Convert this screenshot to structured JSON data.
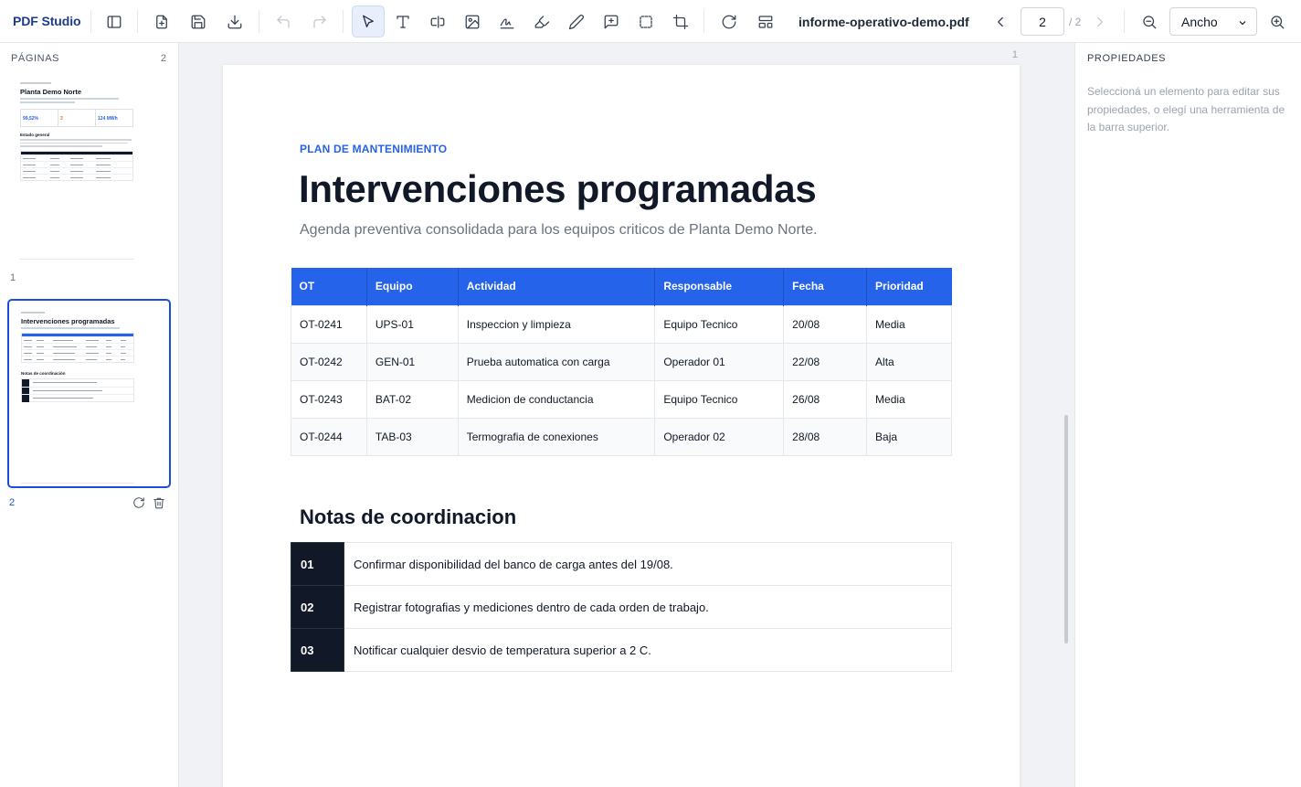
{
  "app": {
    "name": "PDF Studio"
  },
  "toolbar": {
    "filename": "informe-operativo-demo.pdf",
    "current_page": "2",
    "total_pages": "/ 2",
    "zoom": "Ancho",
    "icons": [
      "sidebar-icon",
      "add-file-icon",
      "save-icon",
      "download-icon",
      "undo-icon",
      "redo-icon",
      "cursor-icon",
      "text-icon",
      "text-field-icon",
      "image-icon",
      "signature-icon",
      "highlighter-icon",
      "pencil-icon",
      "comment-icon",
      "rectangle-icon",
      "crop-icon",
      "rotate-icon",
      "layout-icon",
      "chevron-left-icon",
      "chevron-right-icon",
      "zoom-out-icon",
      "zoom-in-icon"
    ]
  },
  "sidebar": {
    "title": "PÁGINAS",
    "count": "2",
    "pages": [
      {
        "number": "1",
        "title": "Planta Demo Norte",
        "kpis": [
          "99,52%",
          "3",
          "124 MWh"
        ],
        "section": "Estado general"
      },
      {
        "number": "2",
        "title": "Intervenciones programadas",
        "section": "Notas de coordinación"
      }
    ]
  },
  "canvas": {
    "page_label": "1"
  },
  "page": {
    "kicker": "PLAN DE MANTENIMIENTO",
    "title": "Intervenciones programadas",
    "subtitle": "Agenda preventiva consolidada para los equipos criticos de Planta Demo Norte.",
    "table": {
      "headers": [
        "OT",
        "Equipo",
        "Actividad",
        "Responsable",
        "Fecha",
        "Prioridad"
      ],
      "rows": [
        [
          "OT-0241",
          "UPS-01",
          "Inspeccion y limpieza",
          "Equipo Tecnico",
          "20/08",
          "Media"
        ],
        [
          "OT-0242",
          "GEN-01",
          "Prueba automatica con carga",
          "Operador 01",
          "22/08",
          "Alta"
        ],
        [
          "OT-0243",
          "BAT-02",
          "Medicion de conductancia",
          "Equipo Tecnico",
          "26/08",
          "Media"
        ],
        [
          "OT-0244",
          "TAB-03",
          "Termografia de conexiones",
          "Operador 02",
          "28/08",
          "Baja"
        ]
      ]
    },
    "notes_title": "Notas de coordinacion",
    "notes": [
      {
        "num": "01",
        "text": "Confirmar disponibilidad del banco de carga antes del 19/08."
      },
      {
        "num": "02",
        "text": "Registrar fotografias y mediciones dentro de cada orden de trabajo."
      },
      {
        "num": "03",
        "text": "Notificar cualquier desvio de temperatura superior a 2 C."
      }
    ]
  },
  "properties": {
    "title": "PROPIEDADES",
    "hint": "Seleccioná un elemento para editar sus propiedades, o elegí una herramienta de la barra superior."
  },
  "colors": {
    "accent": "#2563eb",
    "brand": "#1e3a8a",
    "dark": "#111827",
    "selected_border": "#1d4ed8"
  }
}
